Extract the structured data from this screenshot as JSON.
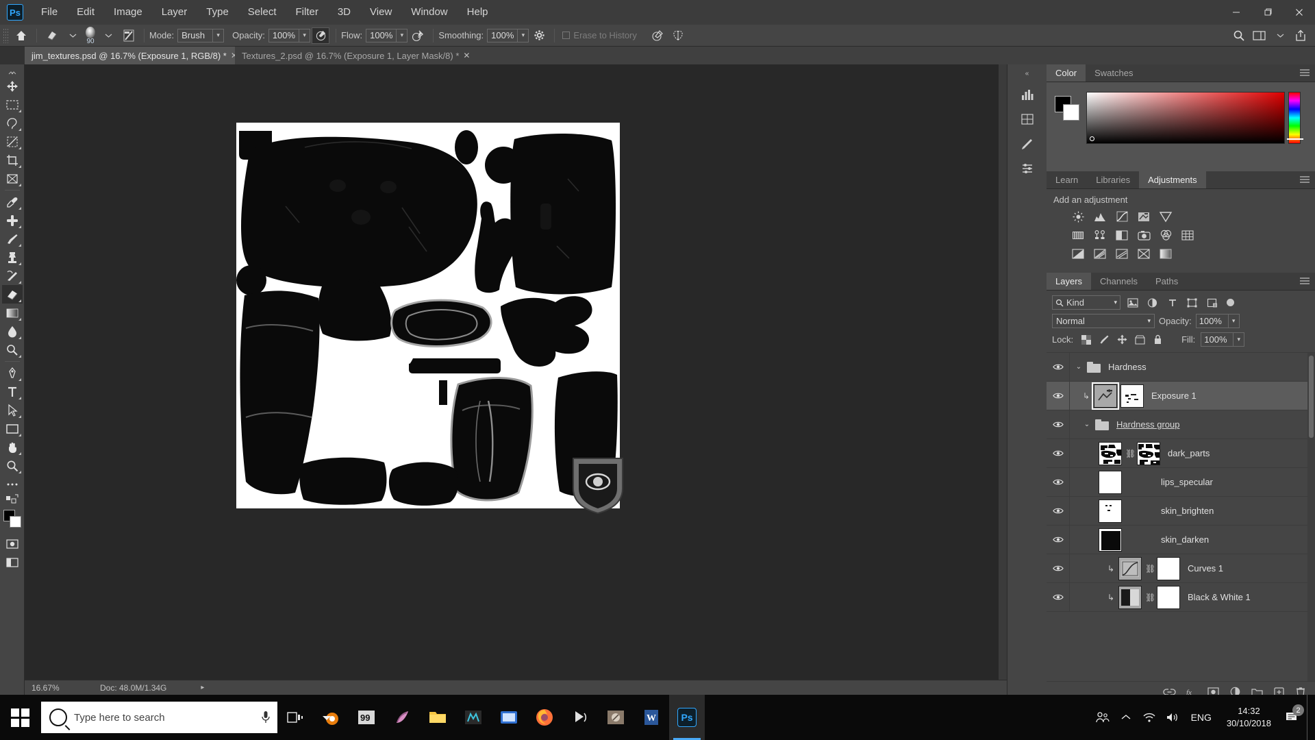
{
  "app": {
    "name": "Adobe Photoshop",
    "logo_text": "Ps",
    "accent_color": "#31a8ff"
  },
  "menubar": {
    "items": [
      {
        "label": "File"
      },
      {
        "label": "Edit"
      },
      {
        "label": "Image"
      },
      {
        "label": "Layer"
      },
      {
        "label": "Type"
      },
      {
        "label": "Select"
      },
      {
        "label": "Filter"
      },
      {
        "label": "3D"
      },
      {
        "label": "View"
      },
      {
        "label": "Window"
      },
      {
        "label": "Help"
      }
    ]
  },
  "window_controls": {
    "minimize": "—",
    "maximize": "❐",
    "close": "✕"
  },
  "options_bar": {
    "tool_preset_icon": "home-icon",
    "eraser_icon": "eraser-icon",
    "brush_size": "90",
    "brush_preview_icon": "brush-tip-preview",
    "brush_panel_icon": "brush-settings-icon",
    "mode_label": "Mode:",
    "mode_value": "Brush",
    "opacity_label": "Opacity:",
    "opacity_value": "100%",
    "pressure_opacity_icon": "pressure-opacity-icon",
    "flow_label": "Flow:",
    "flow_value": "100%",
    "airbrush_icon": "airbrush-icon",
    "smoothing_label": "Smoothing:",
    "smoothing_value": "100%",
    "smoothing_options_icon": "gear-icon",
    "erase_to_history_label": "Erase to History",
    "erase_to_history_checked": false,
    "pressure_size_icon": "pressure-size-icon",
    "symmetry_icon": "symmetry-butterfly-icon",
    "search_icon": "search-icon",
    "workspace_icon": "workspace-icon",
    "share_icon": "share-icon"
  },
  "document_tabs": [
    {
      "title": "jim_textures.psd @ 16.7% (Exposure 1, RGB/8) *",
      "modified": true,
      "active": true,
      "close_icon": "close-icon"
    },
    {
      "title": "Textures_2.psd @ 16.7% (Exposure 1, Layer Mask/8) *",
      "modified": true,
      "active": false,
      "close_icon": "close-icon"
    }
  ],
  "toolbar": {
    "tools": [
      {
        "name": "move-tool",
        "icon": "move-icon",
        "selected": false
      },
      {
        "name": "rectangular-marquee-tool",
        "icon": "marquee-icon",
        "selected": false
      },
      {
        "name": "lasso-tool",
        "icon": "lasso-icon",
        "selected": false
      },
      {
        "name": "object-selection-tool",
        "icon": "quick-selection-icon",
        "selected": false
      },
      {
        "name": "crop-tool",
        "icon": "crop-icon",
        "selected": false
      },
      {
        "name": "frame-tool",
        "icon": "frame-icon",
        "selected": false
      },
      {
        "name": "eyedropper-tool",
        "icon": "eyedropper-icon",
        "selected": false
      },
      {
        "name": "healing-brush-tool",
        "icon": "healing-brush-icon",
        "selected": false
      },
      {
        "name": "brush-tool",
        "icon": "brush-icon",
        "selected": false
      },
      {
        "name": "clone-stamp-tool",
        "icon": "clone-stamp-icon",
        "selected": false
      },
      {
        "name": "history-brush-tool",
        "icon": "history-brush-icon",
        "selected": false
      },
      {
        "name": "eraser-tool",
        "icon": "eraser-icon",
        "selected": true
      },
      {
        "name": "gradient-tool",
        "icon": "gradient-icon",
        "selected": false
      },
      {
        "name": "blur-tool",
        "icon": "blur-drop-icon",
        "selected": false
      },
      {
        "name": "dodge-tool",
        "icon": "dodge-icon",
        "selected": false
      },
      {
        "name": "pen-tool",
        "icon": "pen-icon",
        "selected": false
      },
      {
        "name": "type-tool",
        "icon": "type-t-icon",
        "selected": false
      },
      {
        "name": "path-selection-tool",
        "icon": "path-arrow-icon",
        "selected": false
      },
      {
        "name": "rectangle-tool",
        "icon": "rectangle-icon",
        "selected": false
      },
      {
        "name": "hand-tool",
        "icon": "hand-icon",
        "selected": false
      },
      {
        "name": "zoom-tool",
        "icon": "zoom-magnifier-icon",
        "selected": false
      },
      {
        "name": "edit-toolbar-tool",
        "icon": "ellipsis-icon",
        "selected": false
      }
    ],
    "quick-mask": "quick-mask-icon",
    "screen-mode": "screen-mode-icon",
    "foreground_color": "#000000",
    "background_color": "#ffffff"
  },
  "status_bar": {
    "zoom": "16.67%",
    "doc_label": "Doc: 48.0M/1.34G",
    "expand_icon": "chevron-right-icon"
  },
  "canvas": {
    "document_title": "jim_textures.psd",
    "zoom_level": "16.7%",
    "background_color": "#ffffff",
    "artwork_description": "Black diving-suit UV texture atlas on white background"
  },
  "icon_rail": {
    "collapse_icon": "double-chevron-icon",
    "icons": [
      {
        "name": "rail-icon-histogram",
        "icon": "histogram-icon"
      },
      {
        "name": "rail-icon-info",
        "icon": "info-icon"
      },
      {
        "name": "rail-icon-brush-settings",
        "icon": "brush-settings-icon"
      },
      {
        "name": "rail-icon-properties",
        "icon": "properties-icon"
      }
    ]
  },
  "color_panel": {
    "tabs": [
      {
        "label": "Color",
        "active": true
      },
      {
        "label": "Swatches",
        "active": false
      }
    ],
    "foreground": "#000000",
    "background": "#ffffff",
    "menu_icon": "panel-menu-icon"
  },
  "adjustments_panel": {
    "tabs": [
      {
        "label": "Learn",
        "active": false
      },
      {
        "label": "Libraries",
        "active": false
      },
      {
        "label": "Adjustments",
        "active": true
      }
    ],
    "title": "Add an adjustment",
    "menu_icon": "panel-menu-icon",
    "row1": [
      {
        "name": "brightness-contrast-adjustment",
        "icon": "brightness-icon"
      },
      {
        "name": "levels-adjustment",
        "icon": "levels-icon"
      },
      {
        "name": "curves-adjustment",
        "icon": "curves-icon"
      },
      {
        "name": "exposure-adjustment",
        "icon": "exposure-icon"
      },
      {
        "name": "vibrance-adjustment",
        "icon": "vibrance-icon"
      }
    ],
    "row2": [
      {
        "name": "hue-saturation-adjustment",
        "icon": "hue-saturation-icon"
      },
      {
        "name": "color-balance-adjustment",
        "icon": "color-balance-icon"
      },
      {
        "name": "black-white-adjustment",
        "icon": "black-white-icon"
      },
      {
        "name": "photo-filter-adjustment",
        "icon": "photo-filter-icon"
      },
      {
        "name": "channel-mixer-adjustment",
        "icon": "channel-mixer-icon"
      },
      {
        "name": "color-lookup-adjustment",
        "icon": "color-lookup-icon"
      }
    ],
    "row3": [
      {
        "name": "invert-adjustment",
        "icon": "invert-icon"
      },
      {
        "name": "posterize-adjustment",
        "icon": "posterize-icon"
      },
      {
        "name": "threshold-adjustment",
        "icon": "threshold-icon"
      },
      {
        "name": "selective-color-adjustment",
        "icon": "selective-color-icon"
      },
      {
        "name": "gradient-map-adjustment",
        "icon": "gradient-map-icon"
      }
    ]
  },
  "layers_panel": {
    "tabs": [
      {
        "label": "Layers",
        "active": true
      },
      {
        "label": "Channels",
        "active": false
      },
      {
        "label": "Paths",
        "active": false
      }
    ],
    "menu_icon": "panel-menu-icon",
    "filter": {
      "search_icon": "search-icon",
      "kind_label": "Kind",
      "chevron": "chevron-down-icon",
      "type_icons": [
        {
          "name": "filter-pixel-layers",
          "icon": "image-icon"
        },
        {
          "name": "filter-adjustment-layers",
          "icon": "adjustment-icon"
        },
        {
          "name": "filter-type-layers",
          "icon": "type-t-icon"
        },
        {
          "name": "filter-shape-layers",
          "icon": "shape-icon"
        },
        {
          "name": "filter-smart-objects",
          "icon": "smart-object-icon"
        }
      ],
      "toggle_on": true
    },
    "blend_mode": "Normal",
    "opacity_label": "Opacity:",
    "opacity_value": "100%",
    "lock_label": "Lock:",
    "lock_icons": [
      {
        "name": "lock-transparent-pixels",
        "icon": "checkerboard-icon"
      },
      {
        "name": "lock-image-pixels",
        "icon": "brush-icon"
      },
      {
        "name": "lock-position",
        "icon": "move-arrows-icon"
      },
      {
        "name": "lock-artboard-nesting",
        "icon": "artboard-icon"
      },
      {
        "name": "lock-all",
        "icon": "padlock-icon"
      }
    ],
    "fill_label": "Fill:",
    "fill_value": "100%",
    "layers": [
      {
        "name": "Hardness",
        "type": "group",
        "visible": true,
        "expanded": true,
        "indent": 0,
        "selected": false,
        "clipped": false,
        "has_thumb": false,
        "thumb_kind": "none"
      },
      {
        "name": "Exposure 1",
        "type": "adjustment",
        "visible": true,
        "expanded": false,
        "indent": 1,
        "selected": true,
        "clipped": true,
        "has_thumb": true,
        "thumb_kind": "exposure-adjustment",
        "has_mask": true,
        "mask_kind": "white-mask-with-marks"
      },
      {
        "name": "Hardness group",
        "type": "group",
        "visible": true,
        "expanded": true,
        "indent": 1,
        "selected": false,
        "clipped": false,
        "has_thumb": false,
        "thumb_kind": "none",
        "underlined": true
      },
      {
        "name": "dark_parts",
        "type": "pixel",
        "visible": true,
        "indent": 2,
        "selected": false,
        "clipped": false,
        "has_thumb": true,
        "thumb_kind": "black-white-splotch",
        "has_mask": true,
        "mask_kind": "black-white-splotch",
        "linked": true
      },
      {
        "name": "lips_specular",
        "type": "pixel",
        "visible": true,
        "indent": 2,
        "selected": false,
        "clipped": false,
        "has_thumb": true,
        "thumb_kind": "white",
        "has_mask": false
      },
      {
        "name": "skin_brighten",
        "type": "pixel",
        "visible": true,
        "indent": 2,
        "selected": false,
        "clipped": false,
        "has_thumb": true,
        "thumb_kind": "white-with-specks",
        "has_mask": false
      },
      {
        "name": "skin_darken",
        "type": "pixel",
        "visible": true,
        "indent": 2,
        "selected": false,
        "clipped": false,
        "has_thumb": true,
        "thumb_kind": "black-square-on-white",
        "has_mask": false
      },
      {
        "name": "Curves 1",
        "type": "adjustment",
        "visible": true,
        "indent": 2,
        "selected": false,
        "clipped": true,
        "has_thumb": true,
        "thumb_kind": "curves-adjustment",
        "has_mask": true,
        "mask_kind": "white",
        "linked": true
      },
      {
        "name": "Black & White 1",
        "type": "adjustment",
        "visible": true,
        "indent": 2,
        "selected": false,
        "clipped": true,
        "has_thumb": true,
        "thumb_kind": "black-white-adjustment",
        "has_mask": true,
        "mask_kind": "white",
        "linked": true
      }
    ],
    "footer_icons": [
      {
        "name": "link-layers-button",
        "icon": "link-icon"
      },
      {
        "name": "layer-style-button",
        "icon": "fx-icon"
      },
      {
        "name": "add-layer-mask-button",
        "icon": "mask-icon"
      },
      {
        "name": "new-adjustment-layer-button",
        "icon": "half-circle-icon"
      },
      {
        "name": "new-group-button",
        "icon": "folder-icon"
      },
      {
        "name": "new-layer-button",
        "icon": "new-layer-icon"
      },
      {
        "name": "delete-layer-button",
        "icon": "trash-icon"
      }
    ]
  },
  "taskbar": {
    "start_icon": "windows-logo-icon",
    "search_placeholder": "Type here to search",
    "mic_icon": "microphone-icon",
    "task_view_icon": "task-view-icon",
    "apps": [
      {
        "name": "taskbar-blender",
        "label": "Blender",
        "running": false,
        "active": false
      },
      {
        "name": "taskbar-99",
        "label": "99",
        "running": false,
        "active": false
      },
      {
        "name": "taskbar-substance",
        "label": "Substance",
        "running": false,
        "active": false
      },
      {
        "name": "taskbar-file-explorer",
        "label": "File Explorer",
        "running": false,
        "active": false
      },
      {
        "name": "taskbar-marmoset",
        "label": "Marmoset",
        "running": false,
        "active": false
      },
      {
        "name": "taskbar-media",
        "label": "Media",
        "running": false,
        "active": false
      },
      {
        "name": "taskbar-firefox",
        "label": "Firefox",
        "running": false,
        "active": false
      },
      {
        "name": "taskbar-vlc",
        "label": "VLC",
        "running": false,
        "active": false
      },
      {
        "name": "taskbar-zbrush",
        "label": "ZBrush",
        "running": false,
        "active": false
      },
      {
        "name": "taskbar-word",
        "label": "Word",
        "running": false,
        "active": false
      },
      {
        "name": "taskbar-photoshop",
        "label": "Ps",
        "running": true,
        "active": true
      }
    ],
    "tray": {
      "people_icon": "people-icon",
      "chevron_icon": "chevron-up-icon",
      "network_icon": "wifi-icon",
      "volume_icon": "speaker-icon",
      "language": "ENG",
      "time": "14:32",
      "date": "30/10/2018",
      "notification_icon": "notification-icon",
      "notification_count": "2"
    }
  }
}
